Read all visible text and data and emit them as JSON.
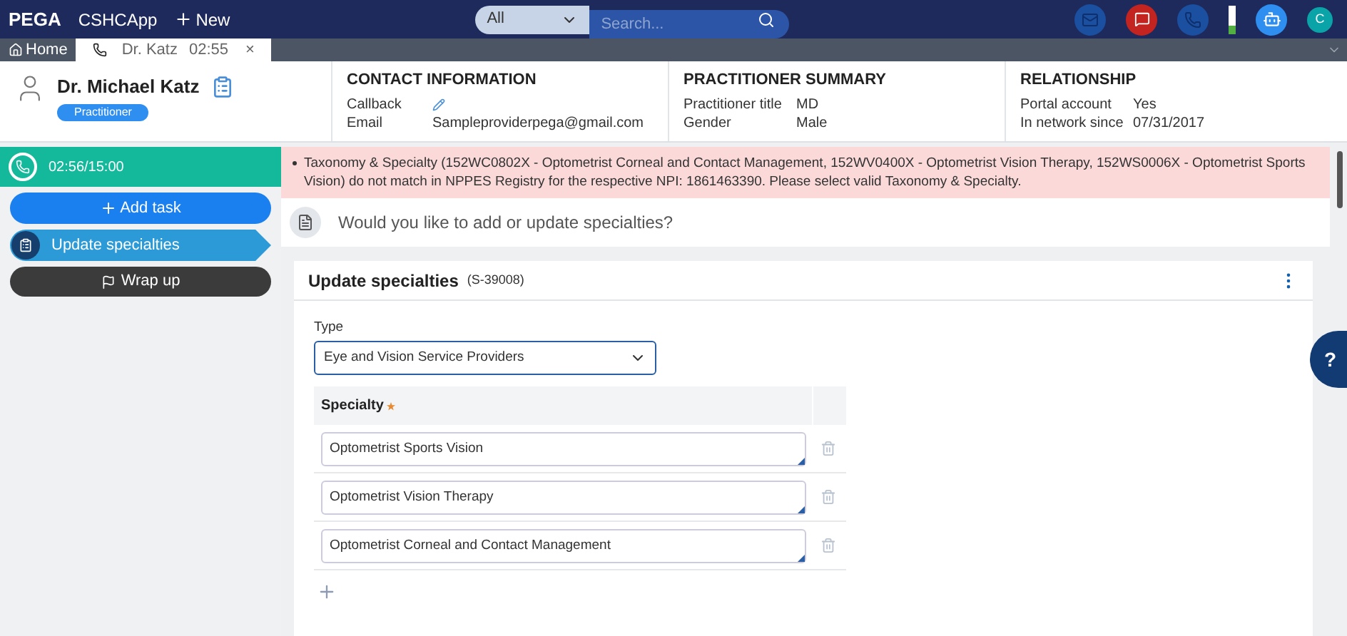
{
  "top_bar": {
    "logo": "PEGA",
    "app": "CSHCApp",
    "new_label": "New",
    "search": {
      "scope": "All",
      "placeholder": "Search..."
    },
    "avatar": "C"
  },
  "tabs": [
    {
      "label": "Home",
      "selected": false,
      "kind": "home"
    },
    {
      "label": "Dr. Katz",
      "time": "02:55",
      "close": "×",
      "selected": true,
      "kind": "call"
    }
  ],
  "header": {
    "name": "Dr. Michael Katz",
    "badge": "Practitioner",
    "sections": [
      {
        "title": "CONTACT INFORMATION",
        "rows": [
          {
            "label": "Callback",
            "kind": "edit"
          },
          {
            "label": "Email",
            "value": "Sampleproviderpega@gmail.com"
          }
        ]
      },
      {
        "title": "PRACTITIONER SUMMARY",
        "rows": [
          {
            "label": "Practitioner title",
            "value": "MD"
          },
          {
            "label": "Gender",
            "value": "Male"
          }
        ]
      },
      {
        "title": "RELATIONSHIP",
        "rows": [
          {
            "label": "Portal account",
            "value": "Yes"
          },
          {
            "label": "In network since",
            "value": "07/31/2017"
          }
        ]
      }
    ]
  },
  "sidebar": {
    "timer": "02:56/15:00",
    "items": [
      {
        "label": "Add task",
        "kind": "add"
      },
      {
        "label": "Update specialties",
        "kind": "current"
      },
      {
        "label": "Wrap up",
        "kind": "wrap"
      }
    ]
  },
  "alert": "Taxonomy & Specialty (152WC0802X - Optometrist Corneal and Contact Management, 152WV0400X - Optometrist Vision Therapy, 152WS0006X - Optometrist Sports Vision) do not match in NPPES Registry for the respective NPI: 1861463390. Please select valid Taxonomy & Specialty.",
  "question": "Would you like to add or update specialties?",
  "card": {
    "title": "Update specialties",
    "case_id": "(S-39008)",
    "type_label": "Type",
    "type_value": "Eye and Vision Service Providers",
    "specialty_header": "Specialty",
    "required": true,
    "specialties": [
      "Optometrist Sports Vision",
      "Optometrist Vision Therapy",
      "Optometrist Corneal and Contact Management"
    ]
  },
  "help": "?"
}
